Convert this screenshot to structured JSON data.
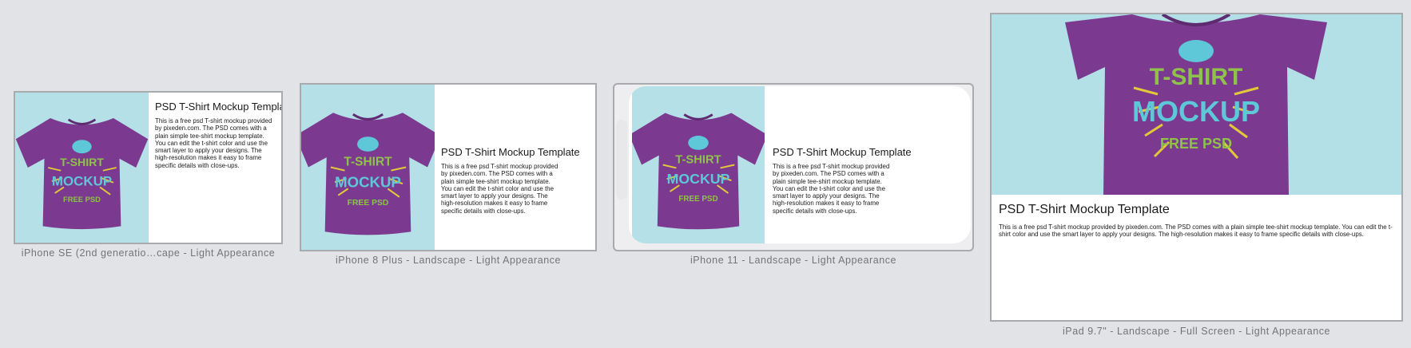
{
  "content": {
    "title": "PSD T-Shirt Mockup Template",
    "description": "This is a free psd T-shirt mockup provided by pixeden.com. The PSD comes with a plain simple tee-shirt mockup template. You can edit the t-shirt color and use the smart layer to apply your designs. The high-resolution makes it easy to frame specific details with close-ups."
  },
  "shirt": {
    "text_line1": "T-SHIRT",
    "text_line2": "MOCKUP",
    "text_line3": "FREE PSD"
  },
  "previews": [
    {
      "caption": "iPhone SE (2nd generatio…cape - Light Appearance"
    },
    {
      "caption": "iPhone 8 Plus - Landscape - Light Appearance"
    },
    {
      "caption": "iPhone 11 - Landscape - Light Appearance"
    },
    {
      "caption": "iPad 9.7\" - Landscape - Full Screen - Light Appearance"
    }
  ],
  "colors": {
    "background": "#e2e3e6",
    "shirt": "#7b3a8f",
    "photo_bg": "#b5e0e7",
    "frame_border": "#a9aaad",
    "caption_text": "#737478"
  }
}
